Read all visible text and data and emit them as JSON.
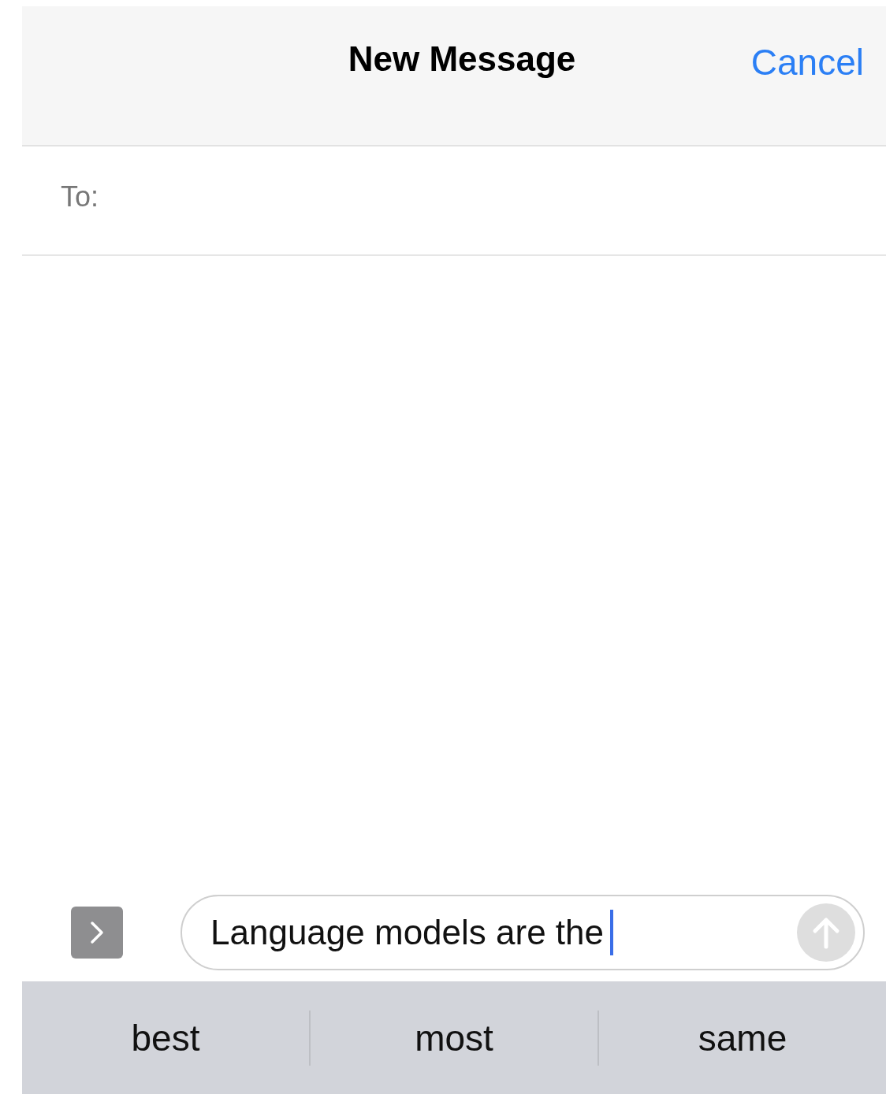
{
  "nav_bar": {
    "title": "New Message",
    "cancel": "Cancel"
  },
  "recipient": {
    "label": "To:"
  },
  "composer": {
    "value": "Language models are the",
    "send_disabled": true
  },
  "suggestions": [
    {
      "word": "best"
    },
    {
      "word": "most"
    },
    {
      "word": "same"
    }
  ]
}
